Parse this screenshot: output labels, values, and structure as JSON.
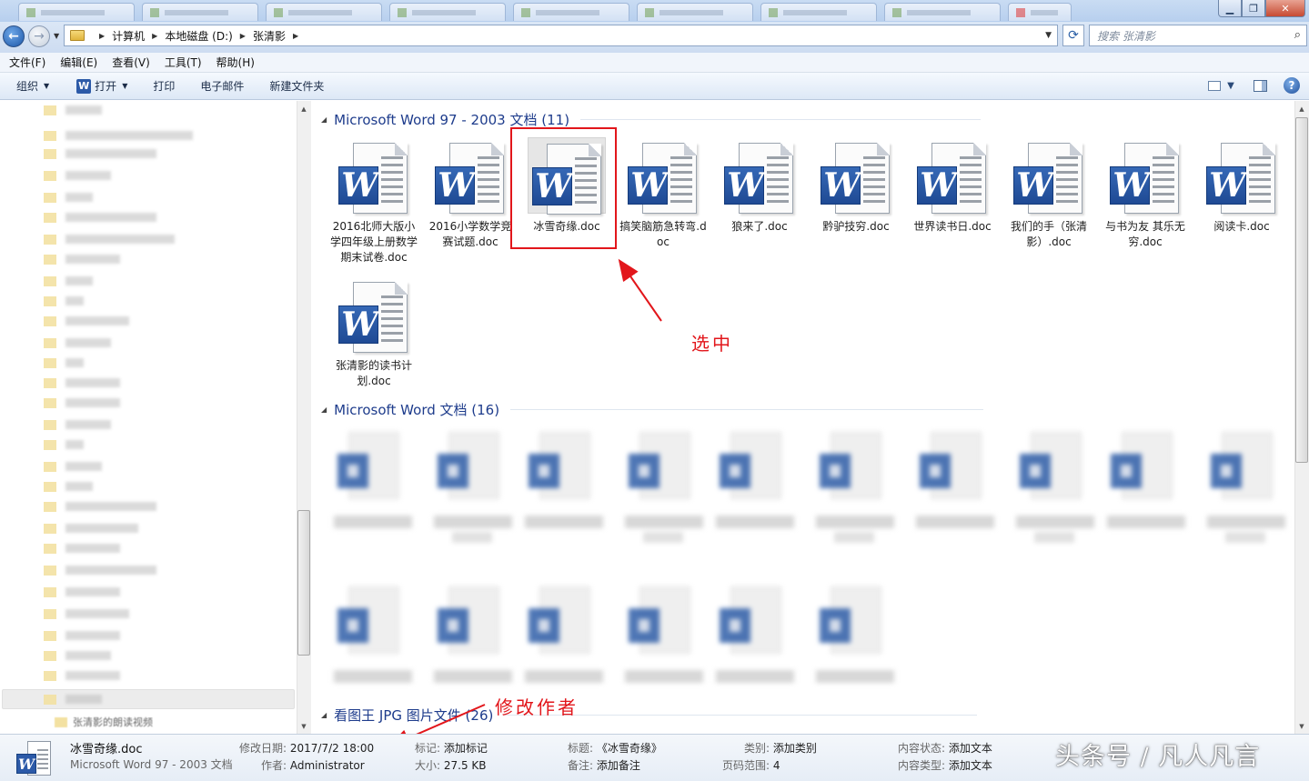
{
  "address": {
    "crumbs": [
      "计算机",
      "本地磁盘 (D:)",
      "张清影"
    ],
    "search_placeholder": "搜索 张清影"
  },
  "menu": [
    "文件(F)",
    "编辑(E)",
    "查看(V)",
    "工具(T)",
    "帮助(H)"
  ],
  "toolbar": {
    "organize": "组织",
    "open": "打开",
    "print": "打印",
    "email": "电子邮件",
    "new_folder": "新建文件夹"
  },
  "nav_last": "张清影的朗读视频",
  "groups": {
    "word97": {
      "label": "Microsoft Word 97 - 2003 文档 (11)"
    },
    "word": {
      "label": "Microsoft Word 文档 (16)"
    },
    "jpg": {
      "label": "看图王 JPG 图片文件 (26)"
    }
  },
  "files": [
    {
      "name": "2016北师大版小学四年级上册数学期末试卷.doc"
    },
    {
      "name": "2016小学数学竞赛试题.doc"
    },
    {
      "name": "冰雪奇缘.doc"
    },
    {
      "name": "搞笑脑筋急转弯.doc"
    },
    {
      "name": "狼来了.doc"
    },
    {
      "name": "黔驴技穷.doc"
    },
    {
      "name": "世界读书日.doc"
    },
    {
      "name": "我们的手（张清影）.doc"
    },
    {
      "name": "与书为友 其乐无穷.doc"
    },
    {
      "name": "阅读卡.doc"
    },
    {
      "name": "张清影的读书计划.doc"
    }
  ],
  "annotations": {
    "selected": "选中",
    "modify_author": "修改作者"
  },
  "details": {
    "name": "冰雪奇缘.doc",
    "type": "Microsoft Word 97 - 2003 文档",
    "modified_label": "修改日期:",
    "modified": "2017/7/2 18:00",
    "author_label": "作者:",
    "author": "Administrator",
    "tags_label": "标记:",
    "tags": "添加标记",
    "size_label": "大小:",
    "size": "27.5 KB",
    "title_label": "标题:",
    "title": "《冰雪奇缘》",
    "comments_label": "备注:",
    "comments": "添加备注",
    "category_label": "类别:",
    "category": "添加类别",
    "pages_label": "页码范围:",
    "pages": "4",
    "content_status_label": "内容状态:",
    "content_status": "添加文本",
    "content_type_label": "内容类型:",
    "content_type": "添加文本"
  },
  "watermark": "头条号 / 凡人凡言",
  "colors": {
    "accent": "#1e3c8c",
    "annotation": "#e2161b",
    "word_blue": "#2c5aa8"
  }
}
